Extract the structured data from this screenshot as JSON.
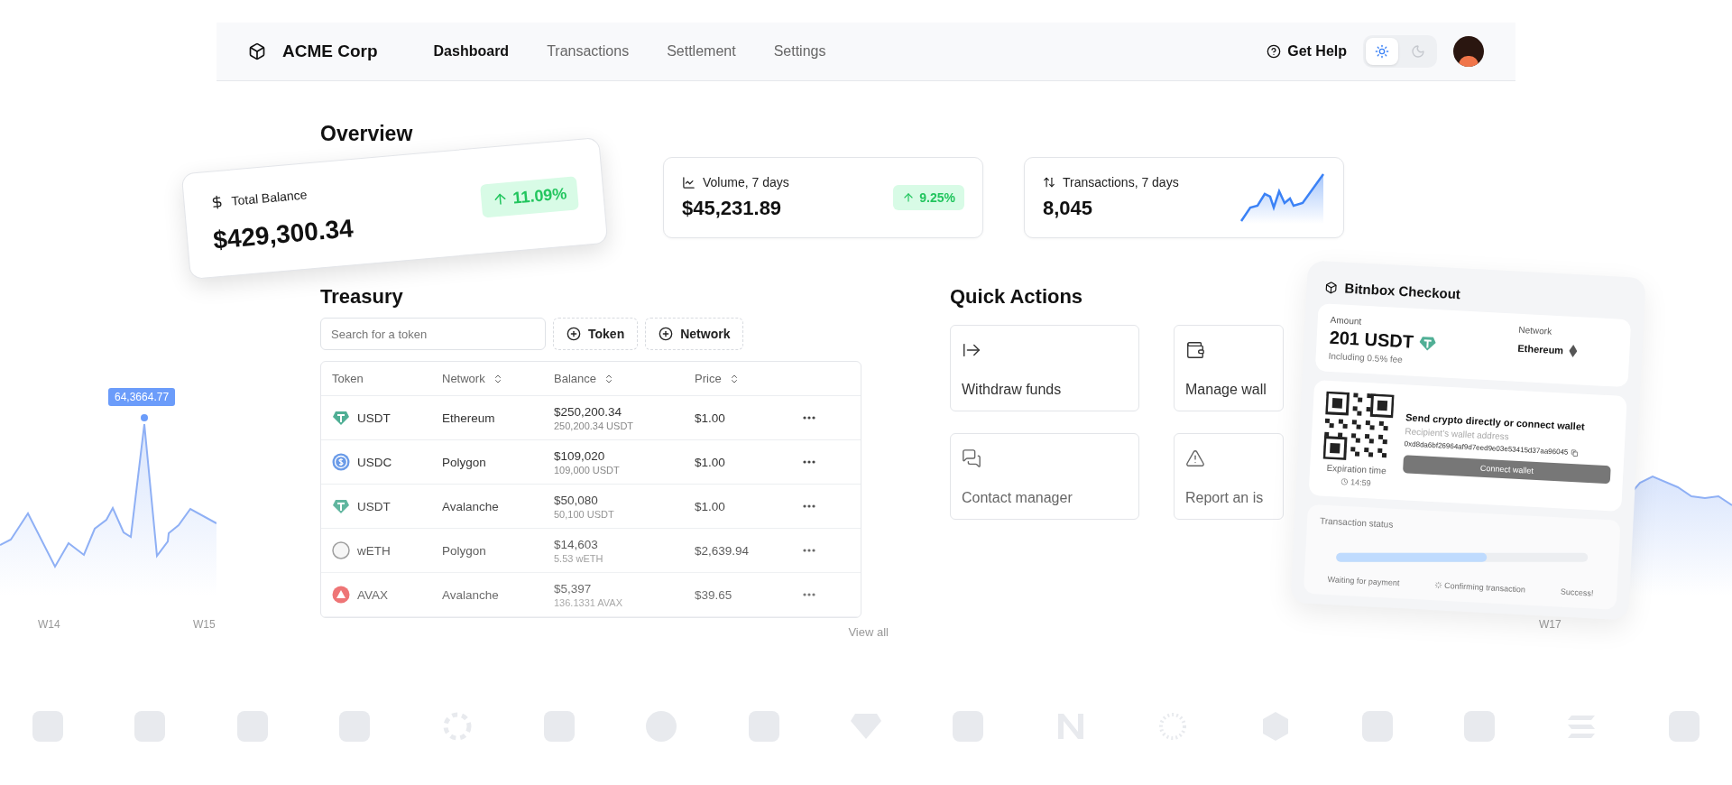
{
  "header": {
    "brand": "ACME Corp",
    "nav": [
      {
        "label": "Dashboard",
        "selected": true
      },
      {
        "label": "Transactions",
        "selected": false
      },
      {
        "label": "Settlement",
        "selected": false
      },
      {
        "label": "Settings",
        "selected": false
      }
    ],
    "help": "Get Help",
    "theme_toggle": [
      {
        "kind": "light",
        "selected": true
      },
      {
        "kind": "dark",
        "selected": false
      }
    ]
  },
  "overview": {
    "title": "Overview",
    "cards": [
      {
        "kind": "balance",
        "label": "Total Balance",
        "value": "$429,300.34",
        "change": "11.09%"
      },
      {
        "kind": "volume",
        "label": "Volume, 7 days",
        "value": "$45,231.89",
        "change": "9.25%"
      },
      {
        "kind": "transactions",
        "label": "Transactions, 7 days",
        "value": "8,045"
      }
    ]
  },
  "treasury": {
    "title": "Treasury",
    "search": {
      "placeholder": "Search for a token"
    },
    "filters": [
      "Token",
      "Network"
    ],
    "columns": [
      {
        "label": "Token",
        "sortable": false
      },
      {
        "label": "Network",
        "sortable": true
      },
      {
        "label": "Balance",
        "sortable": true
      },
      {
        "label": "Price",
        "sortable": true
      }
    ],
    "rows": [
      {
        "kind": "usdt",
        "token": "USDT",
        "network": "Ethereum",
        "balance": "$250,200.34",
        "amount": "250,200.34 USDT",
        "price": "$1.00"
      },
      {
        "kind": "usdc",
        "token": "USDC",
        "network": "Polygon",
        "balance": "$109,020",
        "amount": "109,000 USDT",
        "price": "$1.00"
      },
      {
        "kind": "usdt",
        "token": "USDT",
        "network": "Avalanche",
        "balance": "$50,080",
        "amount": "50,100 USDT",
        "price": "$1.00"
      },
      {
        "kind": "weth",
        "token": "wETH",
        "network": "Polygon",
        "balance": "$14,603",
        "amount": "5.53 wETH",
        "price": "$2,639.94"
      },
      {
        "kind": "avax",
        "token": "AVAX",
        "network": "Avalanche",
        "balance": "$5,397",
        "amount": "136.1331 AVAX",
        "price": "$39.65"
      }
    ],
    "view_all": "View all"
  },
  "quick_actions": {
    "title": "Quick Actions",
    "items": [
      {
        "kind": "withdraw",
        "label": "Withdraw funds"
      },
      {
        "kind": "wallet",
        "label": "Manage wall"
      },
      {
        "kind": "contact",
        "label": "Contact manager"
      },
      {
        "kind": "report",
        "label": "Report an is"
      }
    ]
  },
  "checkout": {
    "title": "Bitnbox Checkout",
    "amount_label": "Amount",
    "amount": "201 USDT",
    "fee": "Including 0.5% fee",
    "network_label": "Network",
    "network": "Ethereum",
    "send_title": "Send crypto directly or connect wallet",
    "address_label": "Recipient’s wallet address",
    "address": "0xd8da6bf26964af9d7eed9e03e53415d37aa96045",
    "expiration_label": "Expiration time",
    "expiration": "14:59",
    "connect_button": "Connect wallet",
    "status_title": "Transaction status",
    "status": {
      "level": 0.6
    },
    "steps": [
      "Waiting for payment",
      "Confirming transaction",
      "Success!"
    ]
  },
  "side_charts": {
    "left": {
      "tooltip": "64,3664.77",
      "x_labels": [
        "W14",
        "W15"
      ]
    },
    "right": {
      "x_labels": [
        "W17"
      ]
    }
  }
}
